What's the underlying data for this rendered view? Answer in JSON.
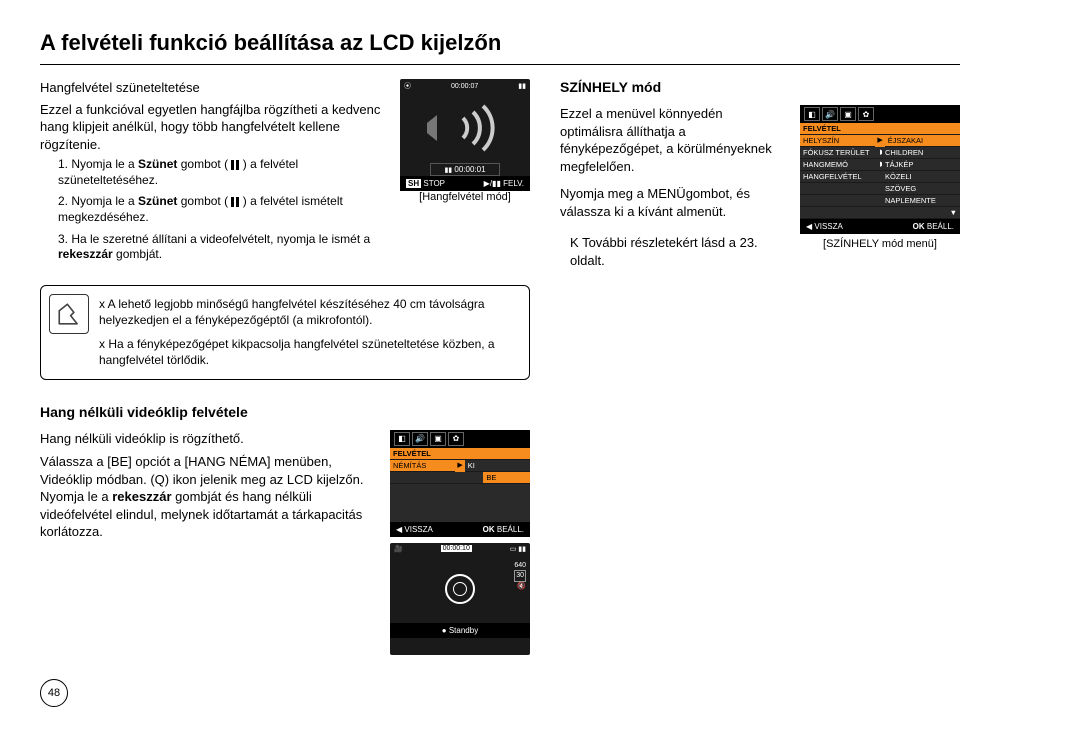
{
  "title": "A felvételi funkció beállítása az LCD kijelzőn",
  "left": {
    "pause_section": {
      "heading": "Hangfelvétel szüneteltetése",
      "intro": "Ezzel a funkcióval egyetlen hangfájlba rögzítheti a kedvenc hang klipjeit anélkül, hogy több hangfelvételt kellene rögzítenie.",
      "step1_a": "1. Nyomja le a ",
      "step1_bold": "Szünet",
      "step1_b": " gombot (",
      "step1_c": ") a felvétel szüneteltetéséhez.",
      "step2_a": "2. Nyomja le a ",
      "step2_bold": "Szünet",
      "step2_b": " gombot (",
      "step2_c": ") a felvétel ismételt megkezdéséhez.",
      "step3_a": "3. Ha le szeretné állítani a videofelvételt, nyomja le ismét a ",
      "step3_bold": "rekeszzár",
      "step3_b": " gombját."
    },
    "lcd1": {
      "time_top": "00:00:07",
      "time_mid": "00:00:01",
      "btn_stop_l": "SH",
      "btn_stop": "STOP",
      "btn_rec": "FELV.",
      "caption": "[Hangfelvétel mód]"
    },
    "note": {
      "bullet1": "A lehető legjobb minőségű hangfelvétel készítéséhez 40 cm távolságra helyezkedjen el a fényképezőgéptől (a mikrofontól).",
      "bullet2": "Ha a fényképezőgépet kikpacsolja hangfelvétel szüneteltetése közben, a hangfelvétel törlődik."
    },
    "mute_section": {
      "heading": "Hang nélküli videóklip felvétele",
      "line1": "Hang nélküli videóklip is rögzíthető.",
      "line2_a": "Válassza a [BE] opciót a [HANG NÉMA] menüben, Videóklip módban. (",
      "line2_b": ") ikon jelenik meg az LCD kijelzőn. Nyomja le a ",
      "line2_bold": "rekeszzár",
      "line2_c": " gombját és hang nélküli videófelvétel elindul, melynek időtartamát a tárkapacitás korlátozza."
    },
    "lcd2": {
      "tab_head": "FELVÉTEL",
      "row_l": "NÉMÍTÁS",
      "row_r1": "KI",
      "row_r2": "BE",
      "back": "VISSZA",
      "ok": "OK",
      "set": "BEÁLL."
    },
    "lcd3": {
      "time": "00:00:10",
      "res": "640",
      "fps": "30",
      "standby": "Standby"
    }
  },
  "right": {
    "scene": {
      "heading": "SZÍNHELY mód",
      "p1": "Ezzel a menüvel könnyedén optimálisra állíthatja a fényképezőgépet, a körülményeknek megfelelően.",
      "p2": "Nyomja meg a MENÜgombot, és válassza ki a kívánt almenüt.",
      "p3": "További részletekért lásd a 23. oldalt."
    },
    "lcd4": {
      "tab_head": "FELVÉTEL",
      "rows_l": [
        "HELYSZÍN",
        "FÓKUSZ TERÜLET",
        "HANGMEMÓ",
        "HANGFELVÉTEL",
        "",
        "",
        ""
      ],
      "rows_r": [
        "ÉJSZAKAI",
        "CHILDREN",
        "TÁJKÉP",
        "KÖZELI",
        "SZÖVEG",
        "NAPLEMENTE",
        ""
      ],
      "back": "VISSZA",
      "ok": "OK",
      "set": "BEÁLL.",
      "caption": "[SZÍNHELY mód menü]"
    }
  },
  "page": "48",
  "glyphs": {
    "q_icon": "Q",
    "x_bullet": "x",
    "k_bullet": "K"
  }
}
